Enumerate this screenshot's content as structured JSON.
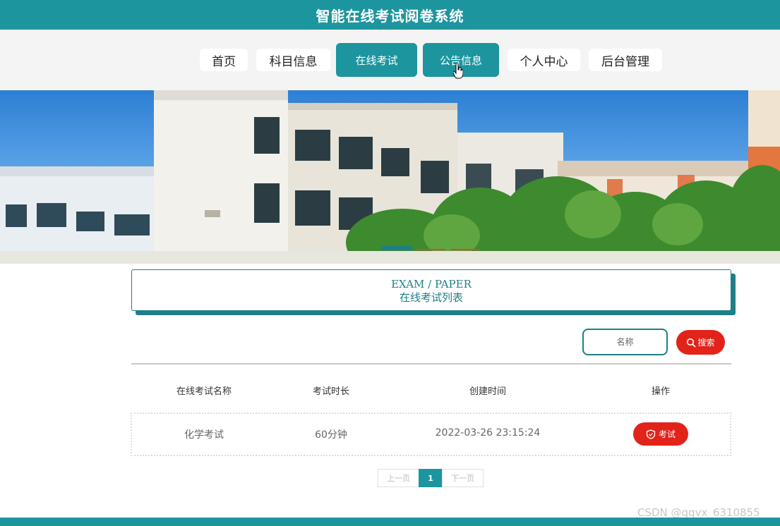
{
  "app": {
    "title": "智能在线考试阅卷系统"
  },
  "nav": {
    "items": [
      {
        "label": "首页"
      },
      {
        "label": "科目信息"
      },
      {
        "label": "在线考试"
      },
      {
        "label": "公告信息"
      },
      {
        "label": "个人中心"
      },
      {
        "label": "后台管理"
      }
    ],
    "active_index": 2,
    "hover_index": 3
  },
  "section": {
    "title_en": "EXAM / PAPER",
    "title_cn": "在线考试列表"
  },
  "search": {
    "placeholder": "名称",
    "button_label": "搜索",
    "icon": "search-icon"
  },
  "table": {
    "headers": [
      "在线考试名称",
      "考试时长",
      "创建时间",
      "操作"
    ],
    "rows": [
      {
        "name": "化学考试",
        "duration": "60分钟",
        "created": "2022-03-26 23:15:24",
        "action_label": "考试",
        "action_icon": "shield-check-icon"
      }
    ]
  },
  "pagination": {
    "prev_label": "上一页",
    "current_page": "1",
    "next_label": "下一页"
  },
  "watermark": "CSDN @qqvx_6310855",
  "colors": {
    "primary": "#1d959f",
    "accent": "#e2231a",
    "text_dark": "#333333"
  }
}
